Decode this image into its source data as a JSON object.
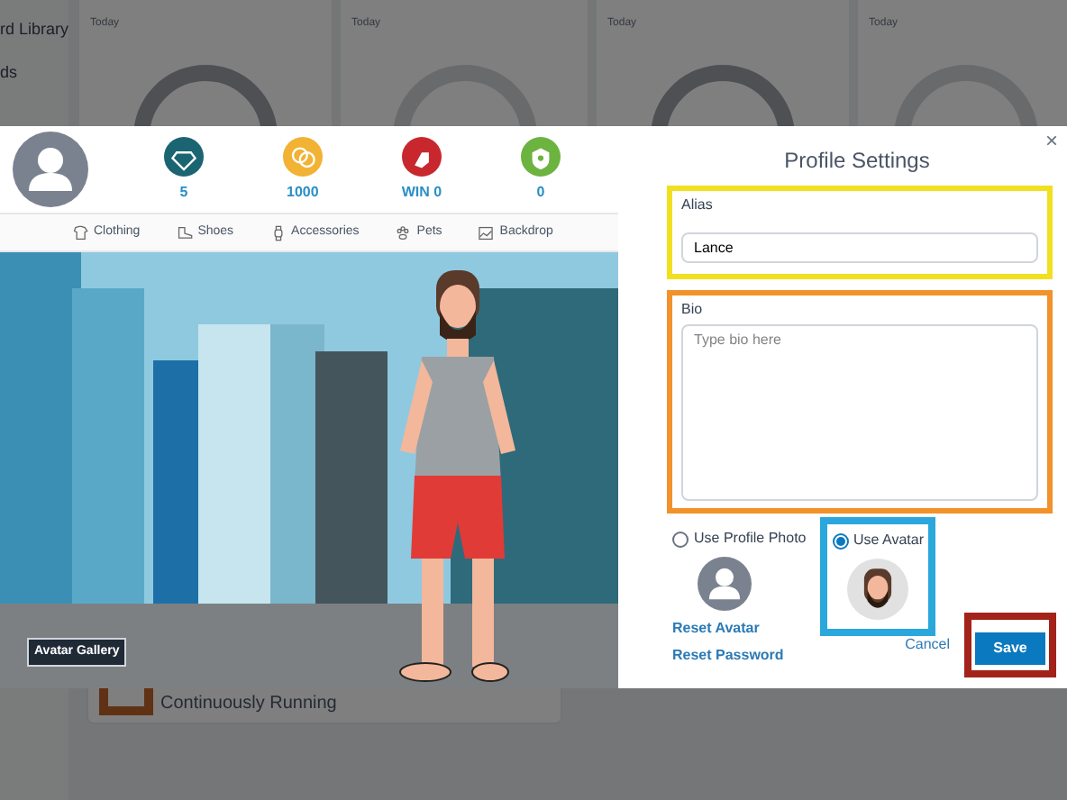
{
  "sidebar": {
    "items": [
      "rd Library",
      "ds"
    ]
  },
  "cards": [
    {
      "subtitle": "Today",
      "ring_dark": true
    },
    {
      "subtitle": "Today",
      "ring_dark": false
    },
    {
      "subtitle": "Today",
      "ring_dark": true
    },
    {
      "subtitle": "Today",
      "ring_dark": false
    }
  ],
  "task": {
    "status": "Continuously Running"
  },
  "modal": {
    "stats": [
      {
        "kind": "gem",
        "value": "5",
        "color": "#1b6572"
      },
      {
        "kind": "coins",
        "value": "1000",
        "color": "#f2b233"
      },
      {
        "kind": "glove",
        "value": "WIN 0",
        "color": "#c8282d"
      },
      {
        "kind": "shield",
        "value": "0",
        "color": "#6cb33f"
      }
    ],
    "tabs": [
      {
        "kind": "shirt",
        "label": "Clothing"
      },
      {
        "kind": "shoe",
        "label": "Shoes"
      },
      {
        "kind": "watch",
        "label": "Accessories"
      },
      {
        "kind": "paw",
        "label": "Pets"
      },
      {
        "kind": "image",
        "label": "Backdrop"
      }
    ],
    "gallery_button": "Avatar Gallery",
    "title": "Profile Settings",
    "close": "×",
    "alias": {
      "label": "Alias",
      "value": "Lance"
    },
    "bio": {
      "label": "Bio",
      "placeholder": "Type bio here"
    },
    "photo_options": [
      {
        "kind": "photo",
        "label": "Use Profile Photo",
        "selected": false
      },
      {
        "kind": "avatar",
        "label": "Use Avatar",
        "selected": true
      }
    ],
    "links": [
      "Reset Avatar",
      "Reset Password"
    ],
    "cancel": "Cancel",
    "save": "Save"
  }
}
